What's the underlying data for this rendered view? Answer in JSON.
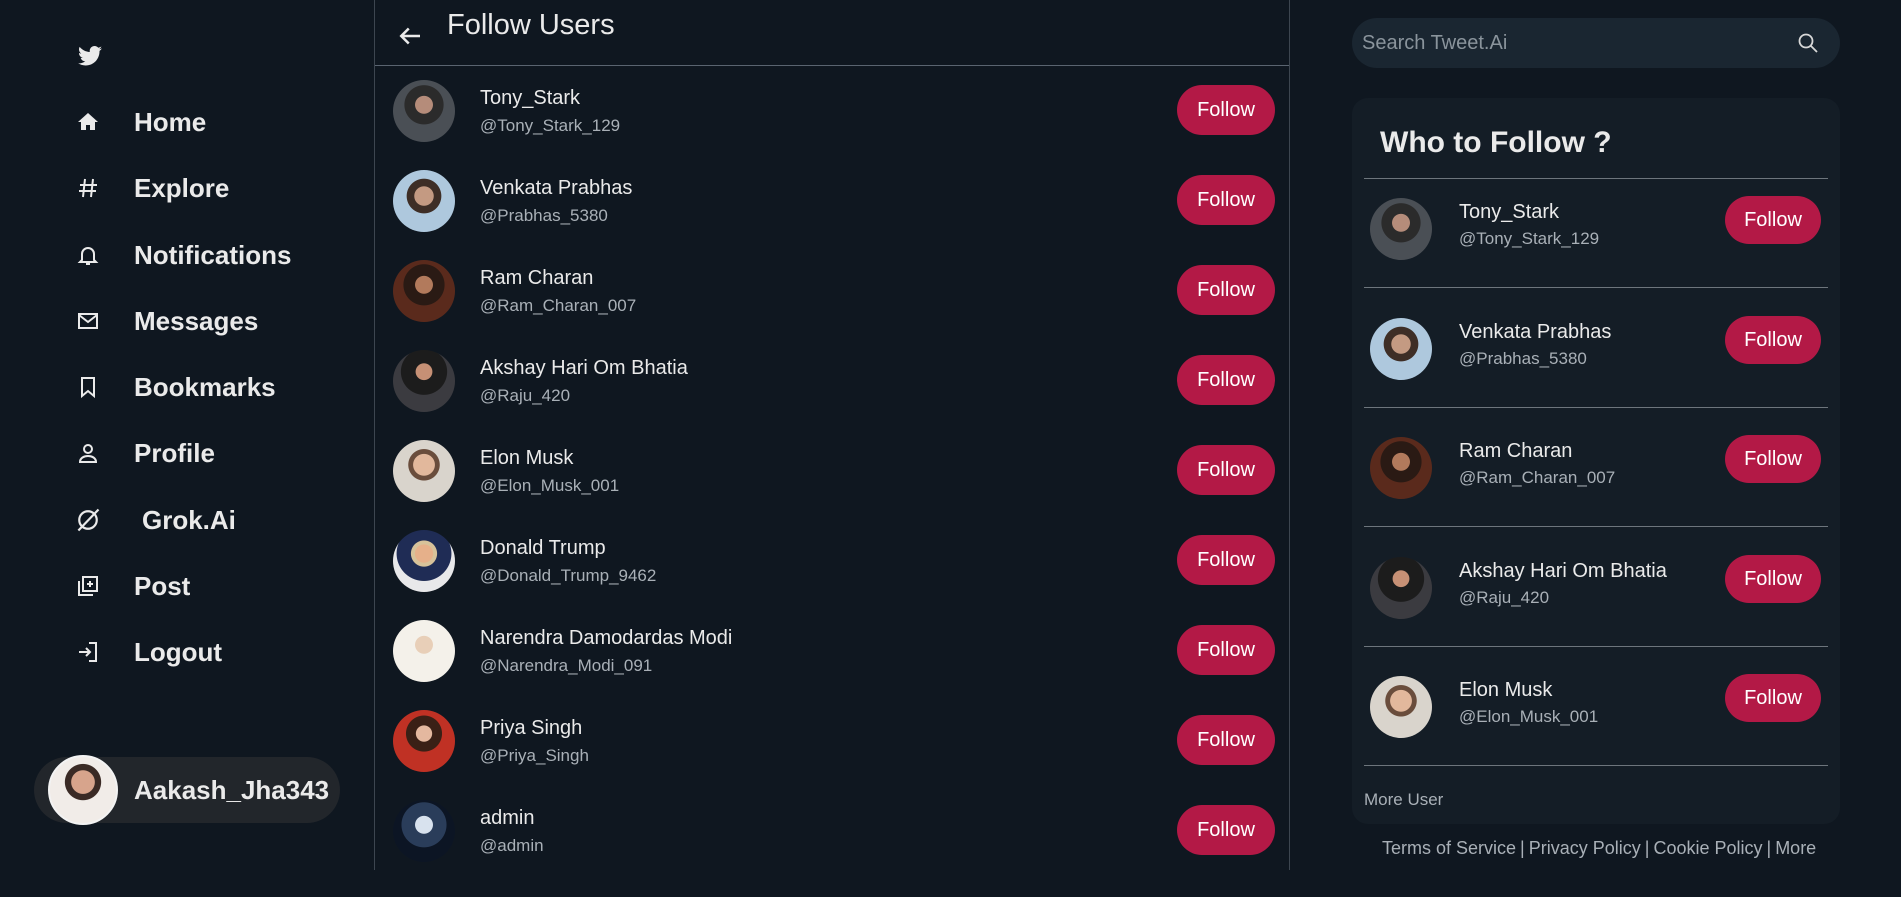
{
  "sidebar": {
    "nav": [
      {
        "label": "Home",
        "icon": "home-icon"
      },
      {
        "label": "Explore",
        "icon": "hashtag-icon"
      },
      {
        "label": "Notifications",
        "icon": "bell-icon"
      },
      {
        "label": "Messages",
        "icon": "mail-icon"
      },
      {
        "label": "Bookmarks",
        "icon": "bookmark-icon"
      },
      {
        "label": "Profile",
        "icon": "person-icon"
      },
      {
        "label": "Grok.Ai",
        "icon": "grok-icon"
      },
      {
        "label": "Post",
        "icon": "post-icon"
      },
      {
        "label": "Logout",
        "icon": "logout-icon"
      }
    ],
    "current_user": "Aakash_Jha343"
  },
  "center": {
    "title": "Follow Users",
    "users": [
      {
        "name": "Tony_Stark",
        "handle": "@Tony_Stark_129",
        "button": "Follow"
      },
      {
        "name": "Venkata Prabhas",
        "handle": "@Prabhas_5380",
        "button": "Follow"
      },
      {
        "name": "Ram Charan",
        "handle": "@Ram_Charan_007",
        "button": "Follow"
      },
      {
        "name": "Akshay Hari Om Bhatia",
        "handle": "@Raju_420",
        "button": "Follow"
      },
      {
        "name": "Elon Musk",
        "handle": "@Elon_Musk_001",
        "button": "Follow"
      },
      {
        "name": "Donald Trump",
        "handle": "@Donald_Trump_9462",
        "button": "Follow"
      },
      {
        "name": "Narendra Damodardas Modi",
        "handle": "@Narendra_Modi_091",
        "button": "Follow"
      },
      {
        "name": "Priya Singh",
        "handle": "@Priya_Singh",
        "button": "Follow"
      },
      {
        "name": "admin",
        "handle": "@admin",
        "button": "Follow"
      }
    ]
  },
  "right": {
    "search_placeholder": "Search Tweet.Ai",
    "who_to_follow_title": "Who to Follow ?",
    "suggestions": [
      {
        "name": "Tony_Stark",
        "handle": "@Tony_Stark_129",
        "button": "Follow"
      },
      {
        "name": "Venkata Prabhas",
        "handle": "@Prabhas_5380",
        "button": "Follow"
      },
      {
        "name": "Ram Charan",
        "handle": "@Ram_Charan_007",
        "button": "Follow"
      },
      {
        "name": "Akshay Hari Om Bhatia",
        "handle": "@Raju_420",
        "button": "Follow"
      },
      {
        "name": "Elon Musk",
        "handle": "@Elon_Musk_001",
        "button": "Follow"
      }
    ],
    "more_user": "More User",
    "footer": {
      "terms": "Terms of Service",
      "privacy": "Privacy Policy",
      "cookie": "Cookie Policy",
      "more": "More",
      "separator": "|"
    }
  },
  "colors": {
    "background": "#0f1720",
    "follow_button": "#b31946",
    "card": "#141d26",
    "search": "#1a2631"
  }
}
